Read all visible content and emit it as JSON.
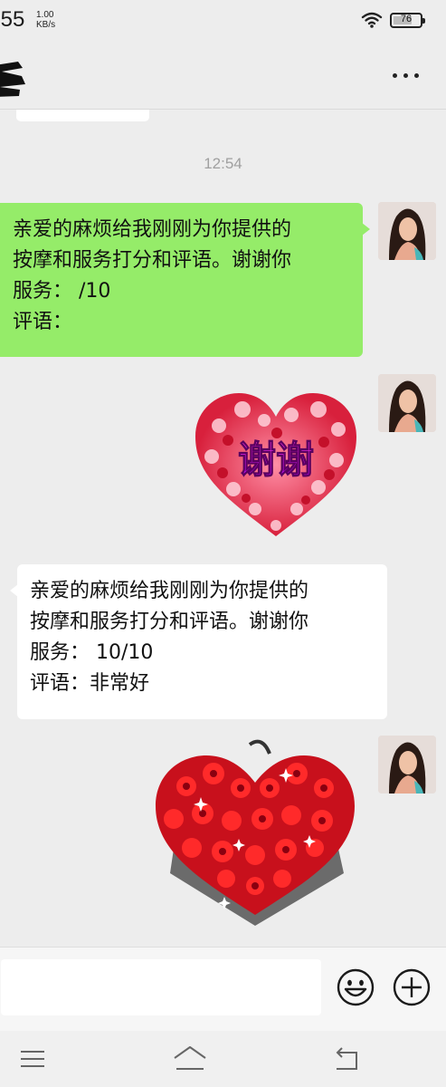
{
  "status_bar": {
    "time": ":55",
    "net_speed_value": "1.00",
    "net_speed_unit": "KB/s",
    "battery": "76",
    "battery_level": 0.76,
    "wifi_icon": "wifi-icon",
    "battery_icon": "battery-icon"
  },
  "header": {
    "more_icon": "more-dots-icon"
  },
  "chat": {
    "timestamp": "12:54",
    "sent_message": {
      "lines": [
        "亲爱的麻烦给我刚刚为你提供的",
        "按摩和服务打分和评语。谢谢你",
        "服务：  /10",
        "评语："
      ]
    },
    "sticker_thanks": {
      "text": "谢谢"
    },
    "received_message": {
      "lines": [
        "亲爱的麻烦给我刚刚为你提供的",
        "按摩和服务打分和评语。谢谢你",
        "服务：  10/10",
        "评语：非常好"
      ]
    },
    "sticker_roses": {
      "icon": "rose-heart-sticker"
    }
  },
  "input_bar": {
    "input_value": "",
    "emoji_icon": "emoji-icon",
    "plus_icon": "plus-icon"
  },
  "nav_bar": {
    "menu_icon": "menu-icon",
    "home_icon": "home-icon",
    "back_icon": "back-icon"
  },
  "colors": {
    "chat_background": "#ededed",
    "sent_bubble": "#95ec69",
    "received_bubble": "#ffffff",
    "timestamp_text": "#a0a0a0"
  }
}
